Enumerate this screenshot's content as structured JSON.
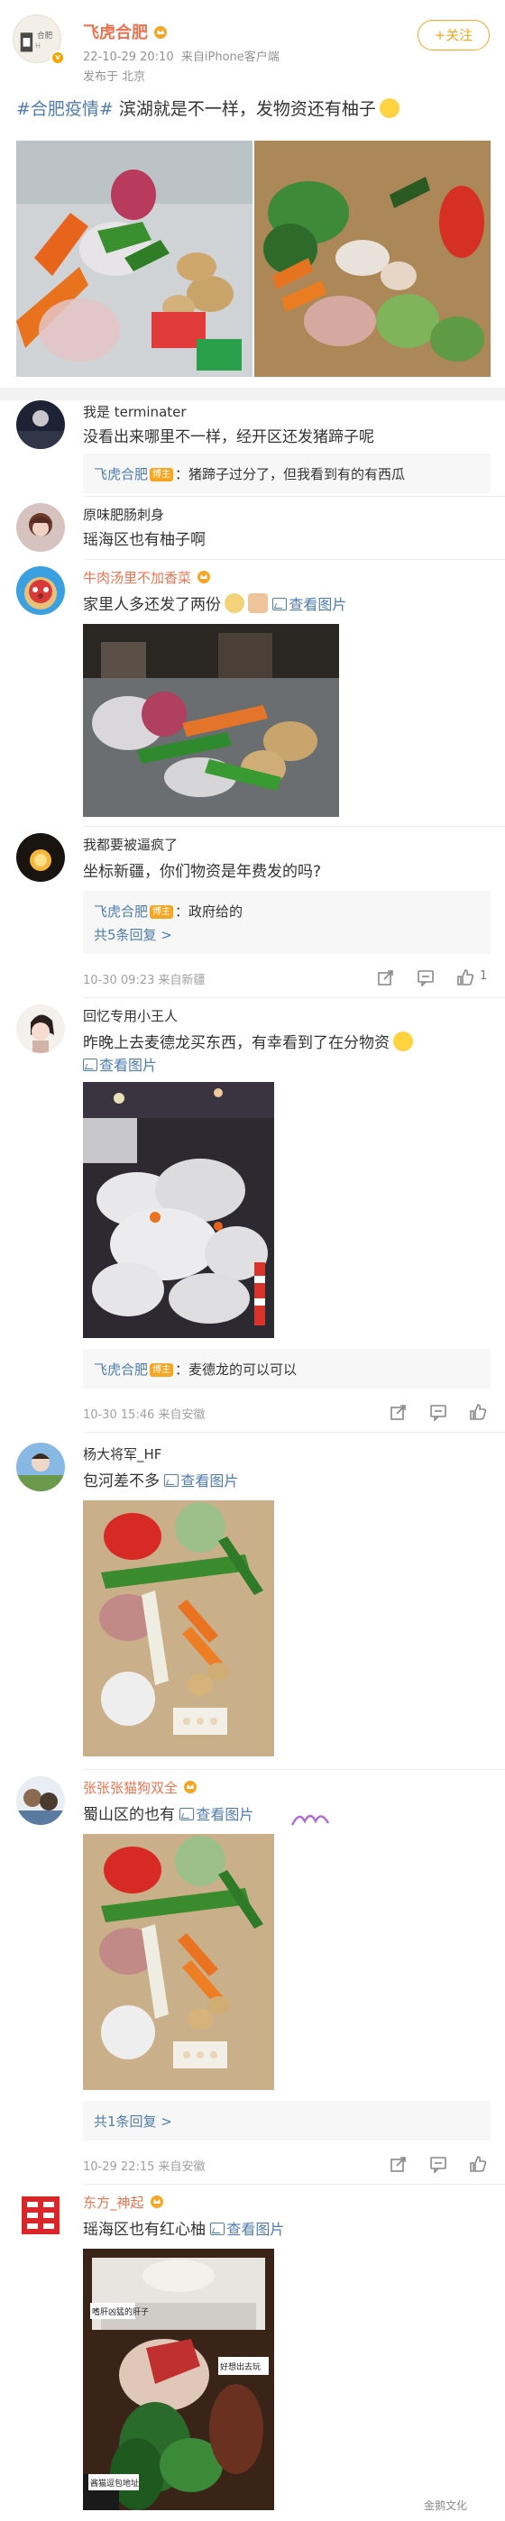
{
  "post": {
    "author": "飞虎合肥",
    "time": "22-10-29 20:10",
    "source": "来自iPhone客户端",
    "location": "发布于 北京",
    "follow": "+关注",
    "hashtag": "#合肥疫情#",
    "text": " 滨湖就是不一样，发物资还有柚子"
  },
  "comments": [
    {
      "name": "我是 terminater",
      "text": "没看出来哪里不一样，经开区还发猪蹄子呢",
      "reply": {
        "name": "飞虎合肥",
        "tag": "博主",
        "text": "：猪蹄子过分了，但我看到有的有西瓜"
      }
    },
    {
      "name": "原味肥肠刺身",
      "text": "瑶海区也有柚子啊"
    },
    {
      "name": "牛肉汤里不加香菜",
      "text": "家里人多还发了两份",
      "link": "查看图片"
    },
    {
      "name": "我都要被逼疯了",
      "text": "坐标新疆，你们物资是年费发的吗?",
      "reply": {
        "name": "飞虎合肥",
        "tag": "博主",
        "text": "：政府给的",
        "more": "共5条回复 >"
      },
      "meta": "10-30 09:23  来自新疆",
      "likes": "1"
    },
    {
      "name": "回忆专用小王人",
      "text": "昨晚上去麦德龙买东西，有幸看到了在分物资",
      "link": "查看图片",
      "reply": {
        "name": "飞虎合肥",
        "tag": "博主",
        "text": "：麦德龙的可以可以"
      },
      "meta": "10-30 15:46  来自安徽"
    },
    {
      "name": "杨大将军_HF",
      "text": "包河差不多",
      "link": "查看图片"
    },
    {
      "name": "张张张猫狗双全",
      "text": "蜀山区的也有",
      "link": "查看图片",
      "reply": {
        "more": "共1条回复 >"
      },
      "meta": "10-29 22:15  来自安徽"
    },
    {
      "name": "东方_神起",
      "text": "瑶海区也有红心柚",
      "link": "查看图片"
    }
  ],
  "photo_notes": [
    "嗜肝凶猛的肝子",
    "好想出去玩",
    "酱猫逗包地址"
  ],
  "watermark": "金鹅文化"
}
